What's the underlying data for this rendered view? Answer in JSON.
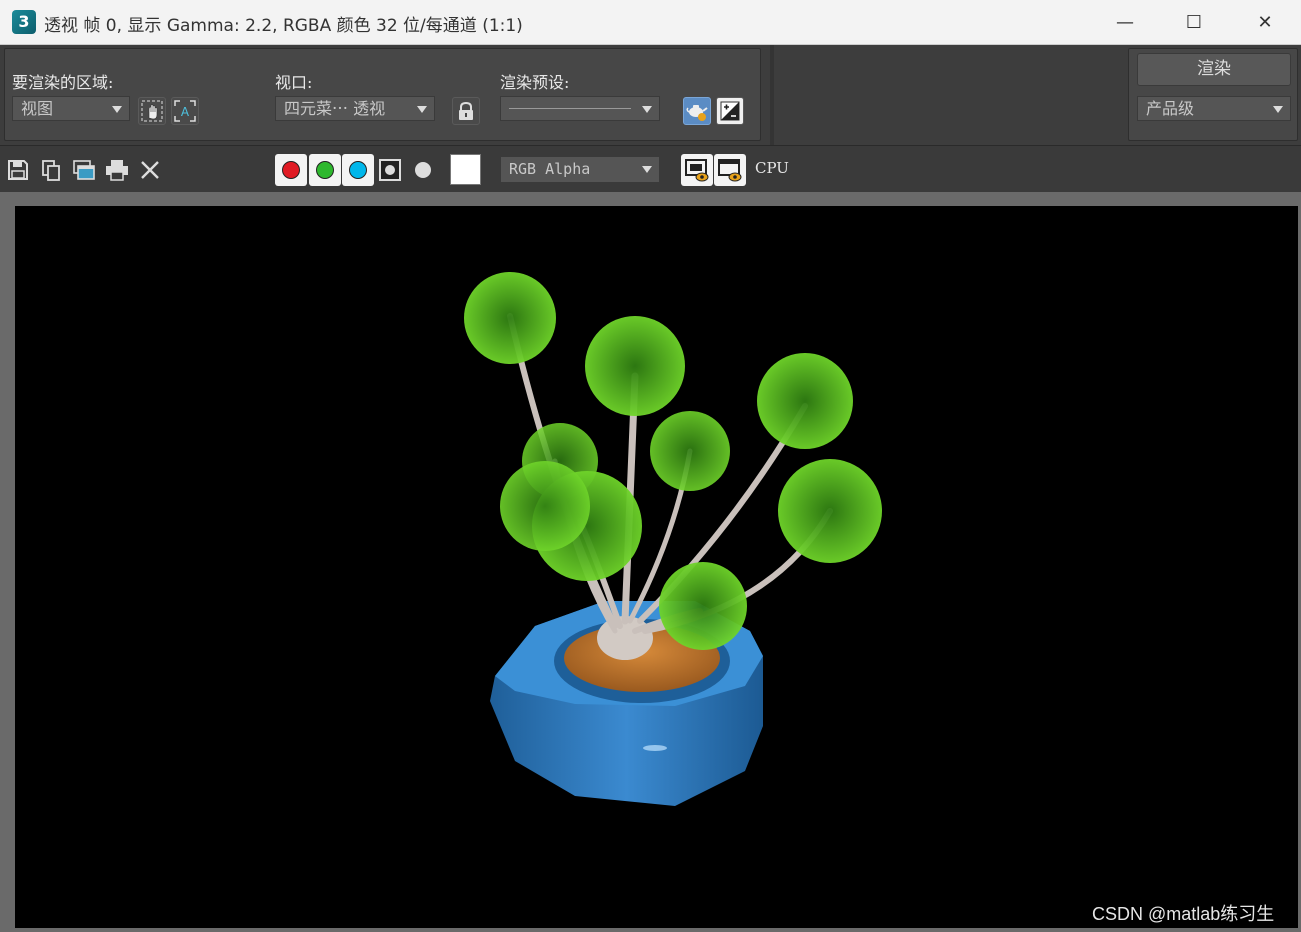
{
  "window": {
    "title": "透视 帧 0, 显示 Gamma: 2.2, RGBA 颜色 32 位/每通道 (1:1)",
    "app_icon_text": "3",
    "minimize_glyph": "—",
    "maximize_glyph": "☐",
    "close_glyph": "✕"
  },
  "render_area": {
    "label": "要渲染的区域:",
    "value": "视图"
  },
  "viewport": {
    "label": "视口:",
    "value": "四元菜⋯ 透视"
  },
  "render_preset": {
    "label": "渲染预设:",
    "value": ""
  },
  "render_button": {
    "label": "渲染"
  },
  "quality": {
    "value": "产品级"
  },
  "toolbar": {
    "channel_display": "RGB Alpha",
    "renderer": "CPU",
    "channel_colors": {
      "red": "#e01b24",
      "green": "#2eb82e",
      "blue": "#00b7eb"
    }
  },
  "watermark": "CSDN @matlab练习生",
  "colors": {
    "pot": "#2f7fc1",
    "soil": "#c87a2f",
    "trunk": "#c9c0bb",
    "leaves": "#4fb81c"
  }
}
